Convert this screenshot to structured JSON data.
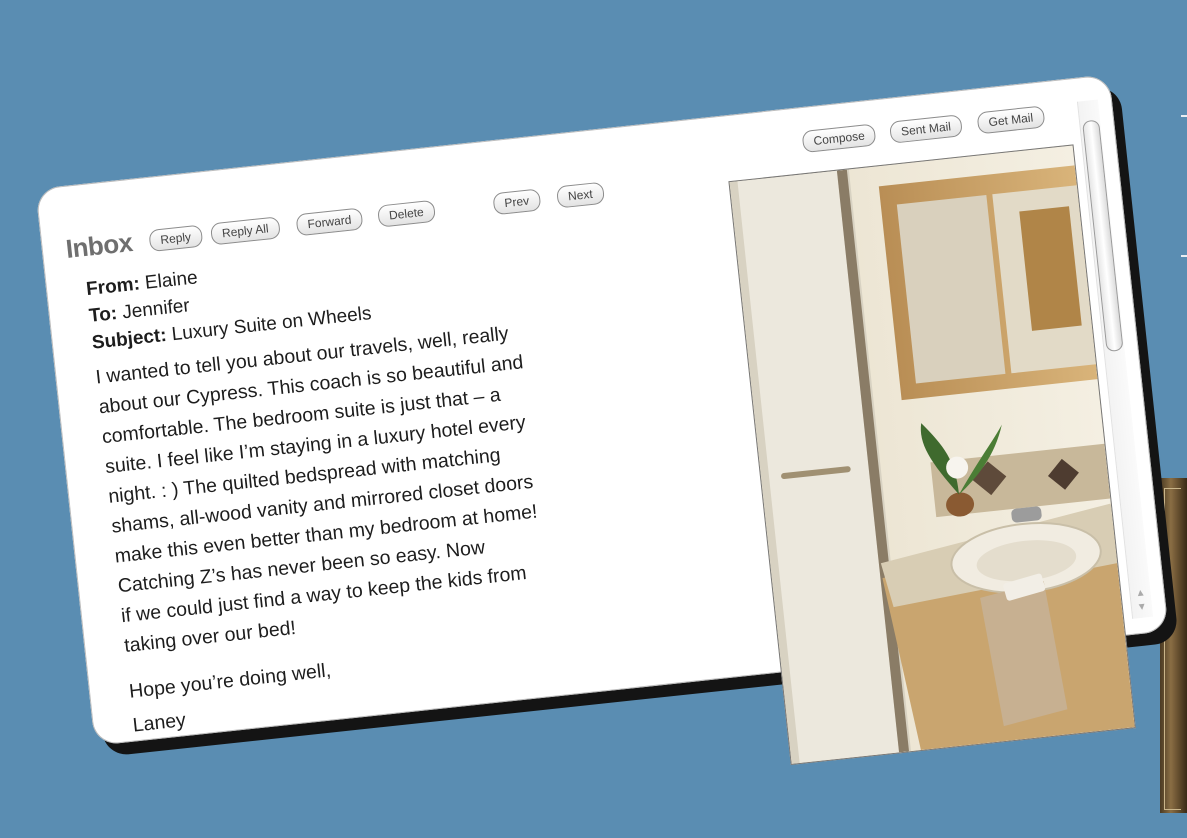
{
  "window": {
    "title": "Inbox"
  },
  "toolbar": {
    "reply": "Reply",
    "reply_all": "Reply All",
    "forward": "Forward",
    "delete": "Delete",
    "prev": "Prev",
    "next": "Next",
    "compose": "Compose",
    "sent_mail": "Sent Mail",
    "get_mail": "Get Mail"
  },
  "message": {
    "from_label": "From:",
    "from": "Elaine",
    "to_label": "To:",
    "to": "Jennifer",
    "subject_label": "Subject:",
    "subject": "Luxury Suite on Wheels",
    "body_lines": [
      "I wanted to tell you about our travels, well, really",
      "about our Cypress. This coach is so beautiful and",
      "comfortable. The bedroom suite is just that – a",
      "suite. I feel like I’m staying in a luxury hotel every",
      "night. : ) The quilted bedspread with matching",
      "shams, all-wood vanity and mirrored closet doors",
      "make this even better than my bedroom at home!",
      "Catching Z’s has never been so easy. Now",
      "if we could just find a way to keep the kids from",
      "taking over our bed!"
    ],
    "closing": "Hope you’re doing well,",
    "signature": "Laney"
  },
  "colors": {
    "background": "#5a8db2",
    "window": "#ffffff",
    "shadow": "#141414"
  }
}
